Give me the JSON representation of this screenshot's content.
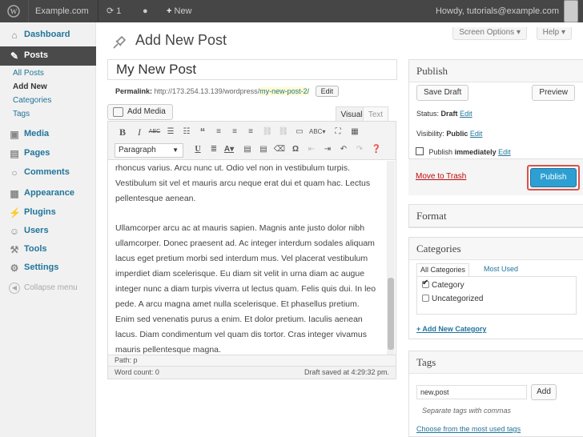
{
  "admin_bar": {
    "site_name": "Example.com",
    "updates_count": "1",
    "new_label": "New",
    "howdy": "Howdy, tutorials@example.com"
  },
  "sidebar": {
    "dashboard": "Dashboard",
    "posts": "Posts",
    "sub_items": [
      "All Posts",
      "Add New",
      "Categories",
      "Tags"
    ],
    "media": "Media",
    "pages": "Pages",
    "comments": "Comments",
    "appearance": "Appearance",
    "plugins": "Plugins",
    "users": "Users",
    "tools": "Tools",
    "settings": "Settings",
    "collapse": "Collapse menu"
  },
  "top_buttons": {
    "screen_options": "Screen Options",
    "help": "Help"
  },
  "page": {
    "title": "Add New Post"
  },
  "post": {
    "title": "My New Post",
    "permalink_label": "Permalink:",
    "permalink_base": "http://173.254.13.139/wordpress/",
    "permalink_slug": "my-new-post-2/",
    "permalink_edit": "Edit"
  },
  "editor": {
    "add_media": "Add Media",
    "tab_visual": "Visual",
    "tab_text": "Text",
    "format_select": "Paragraph",
    "paragraphs": [
      "rhoncus varius. Arcu nunc ut. Odio vel non in vestibulum turpis. Vestibulum sit vel et mauris arcu neque erat dui et quam hac. Lectus pellentesque aenean.",
      "Ullamcorper arcu ac at mauris sapien. Magnis ante justo dolor nibh ullamcorper. Donec praesent ad. Ac integer interdum sodales aliquam lacus eget pretium morbi sed interdum mus. Vel placerat vestibulum imperdiet diam scelerisque. Eu diam sit velit in urna diam ac augue integer nunc a diam turpis viverra ut lectus quam. Felis quis dui. In leo pede. A arcu magna amet nulla scelerisque. Et phasellus pretium. Enim sed venenatis purus a enim. Et dolor pretium. Iaculis aenean lacus. Diam condimentum vel quam dis tortor. Cras integer vivamus mauris pellentesque magna."
    ],
    "path": "Path: p",
    "word_count": "Word count: 0",
    "draft_saved": "Draft saved at 4:29:32 pm."
  },
  "publish": {
    "heading": "Publish",
    "save_draft": "Save Draft",
    "preview": "Preview",
    "status_label": "Status:",
    "status_value": "Draft",
    "visibility_label": "Visibility:",
    "visibility_value": "Public",
    "publish_label": "Publish",
    "publish_value": "immediately",
    "edit": "Edit",
    "trash": "Move to Trash",
    "publish_button": "Publish"
  },
  "format": {
    "heading": "Format"
  },
  "categories": {
    "heading": "Categories",
    "tab_all": "All Categories",
    "tab_used": "Most Used",
    "items": [
      {
        "label": "Category",
        "checked": true
      },
      {
        "label": "Uncategorized",
        "checked": false
      }
    ],
    "add_new": "+ Add New Category"
  },
  "tags": {
    "heading": "Tags",
    "input_value": "new,post",
    "add": "Add",
    "help": "Separate tags with commas",
    "choose": "Choose from the most used tags"
  },
  "colors": {
    "admin_bar": "#464646",
    "link": "#21759b",
    "publish_button": "#2e9fd2",
    "highlight_border": "#d9534f",
    "trash": "#bc0b0b"
  }
}
